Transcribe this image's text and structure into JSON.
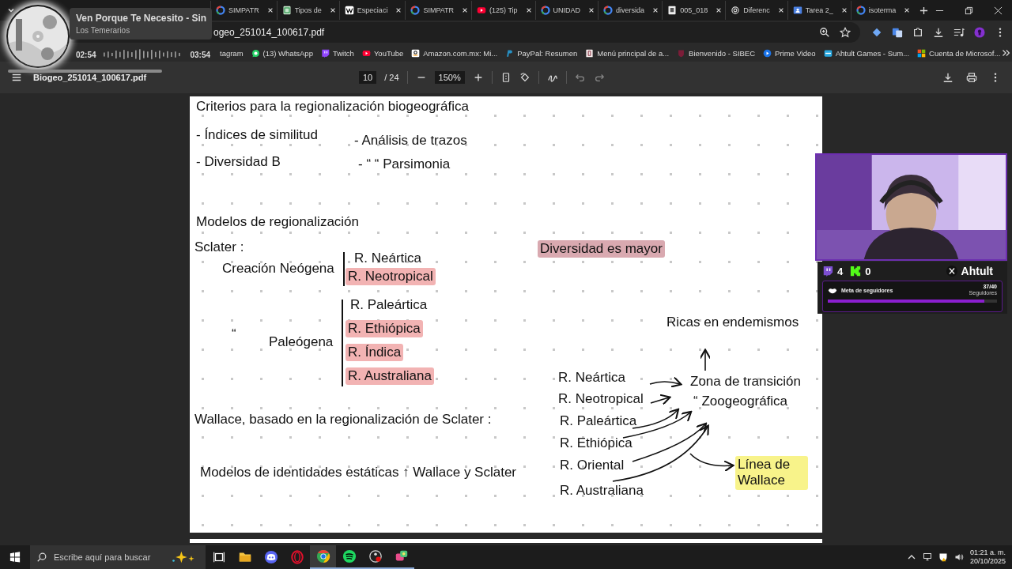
{
  "music_player": {
    "title": "Ven Porque Te Necesito - Sin",
    "artist": "Los Temerarios",
    "elapsed": "02:54",
    "total": "03:54"
  },
  "browser": {
    "tabs": [
      {
        "title": "SIMPATR",
        "kind": "google",
        "selected": false
      },
      {
        "title": "Tipos de",
        "kind": "sheet",
        "selected": false
      },
      {
        "title": "Especiaci",
        "kind": "wiki",
        "selected": false
      },
      {
        "title": "SIMPATR",
        "kind": "google",
        "selected": false
      },
      {
        "title": "(125) Tip",
        "kind": "youtube",
        "selected": false
      },
      {
        "title": "UNIDAD",
        "kind": "google",
        "selected": false
      },
      {
        "title": "diversida",
        "kind": "google",
        "selected": false
      },
      {
        "title": "005_018",
        "kind": "doc",
        "selected": false
      },
      {
        "title": "Diferenc",
        "kind": "gpt",
        "selected": false
      },
      {
        "title": "Tarea 2_",
        "kind": "classroom",
        "selected": false
      },
      {
        "title": "isoterma",
        "kind": "google",
        "selected": false
      }
    ],
    "address": "ogeo_251014_100617.pdf",
    "bookmarks": [
      {
        "label": "tagram",
        "kind": "none"
      },
      {
        "label": "(13) WhatsApp",
        "kind": "whatsapp"
      },
      {
        "label": "Twitch",
        "kind": "twitch"
      },
      {
        "label": "YouTube",
        "kind": "youtube"
      },
      {
        "label": "Amazon.com.mx: Mi...",
        "kind": "amazon"
      },
      {
        "label": "PayPal: Resumen",
        "kind": "paypal"
      },
      {
        "label": "Menú principal de a...",
        "kind": "page"
      },
      {
        "label": "Bienvenido - SIBEC",
        "kind": "sibec"
      },
      {
        "label": "Prime Video",
        "kind": "prime"
      },
      {
        "label": "Ahtult Games - Sum...",
        "kind": "ahtult"
      },
      {
        "label": "Cuenta de Microsof...",
        "kind": "microsoft"
      }
    ]
  },
  "pdf_toolbar": {
    "file_name": "Biogeo_251014_100617.pdf",
    "page": "10",
    "page_total": "/ 24",
    "zoom": "150%"
  },
  "notes": [
    {
      "text": "Criterios para la regionalización biogeográfica"
    },
    {
      "text": "- Índices de similitud"
    },
    {
      "text": "- Análisis de trazos"
    },
    {
      "text": "- Diversidad B"
    },
    {
      "text": "-  “      “  Parsimonia"
    },
    {
      "text": "Modelos de regionalización"
    },
    {
      "text": "Sclater :"
    },
    {
      "text": "Creación Neógena"
    },
    {
      "text": "R. Neártica"
    },
    {
      "text": "R. Neotropical",
      "color": "#f2b3b3"
    },
    {
      "text": "“"
    },
    {
      "text": "Paleógena"
    },
    {
      "text": "R. Paleártica"
    },
    {
      "text": "R. Ethiópica",
      "color": "#f2b3b3"
    },
    {
      "text": "R. Índica",
      "color": "#f2b3b3"
    },
    {
      "text": "R. Australiana",
      "color": "#f2b3b3"
    },
    {
      "text": "Wallace, basado en la regionalización de Sclater :"
    },
    {
      "text": "Modelos de identidades estáticas ↑ Wallace y Sclater"
    },
    {
      "text": "Diversidad es mayor",
      "color": "#d9a9b0"
    },
    {
      "text": "Ricas en endemismos"
    },
    {
      "text": "R. Neártica"
    },
    {
      "text": "R. Neotropical"
    },
    {
      "text": "R. Paleártica"
    },
    {
      "text": "R. Ethiópica"
    },
    {
      "text": "R. Oriental"
    },
    {
      "text": "R. Australiana"
    },
    {
      "text": "Zona de transición"
    },
    {
      "text": "“  Zoogeográfica"
    },
    {
      "text": "Línea de Wallace",
      "color": "#f8f38a"
    }
  ],
  "stream_overlay": {
    "twitch_count": "4",
    "kick_count": "0",
    "channel": "Ahtult",
    "goal_label": "Meta de seguidores",
    "goal_count": "37/40",
    "goal_unit": "Seguidores",
    "level": 0.925
  },
  "taskbar": {
    "search_placeholder": "Escribe aquí para buscar",
    "apps": [
      {
        "kind": "taskview",
        "active": false,
        "running": false
      },
      {
        "kind": "folder",
        "active": false,
        "running": false
      },
      {
        "kind": "discord",
        "active": false,
        "running": false
      },
      {
        "kind": "opera",
        "active": false,
        "running": false
      },
      {
        "kind": "chrome",
        "active": true,
        "running": true
      },
      {
        "kind": "spotify",
        "active": false,
        "running": true
      },
      {
        "kind": "obs",
        "active": false,
        "running": true
      },
      {
        "kind": "chat",
        "active": false,
        "running": true
      }
    ],
    "time": "01:21 a. m.",
    "date": "20/10/2025"
  }
}
